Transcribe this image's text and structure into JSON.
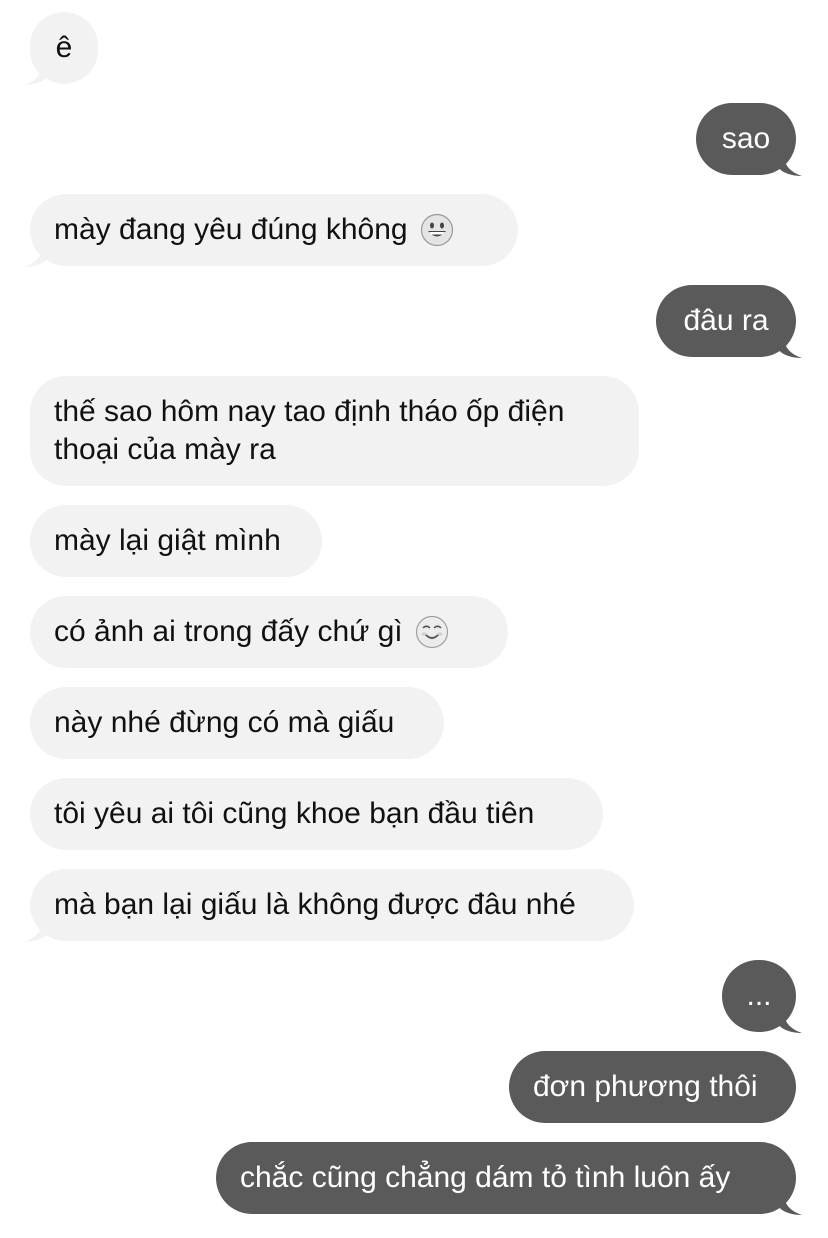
{
  "conversation": {
    "messages": [
      {
        "side": "in",
        "text": "ê"
      },
      {
        "side": "out",
        "text": "sao"
      },
      {
        "side": "in",
        "text": "mày đang yêu đúng không",
        "emoji": "grinning-face-icon"
      },
      {
        "side": "out",
        "text": "đâu ra"
      },
      {
        "side": "in",
        "text": "thế sao hôm nay tao định tháo ốp điện thoại của mày ra"
      },
      {
        "side": "in",
        "text": "mày lại giật mình"
      },
      {
        "side": "in",
        "text": "có ảnh ai trong đấy chứ gì",
        "emoji": "smiling-face-icon"
      },
      {
        "side": "in",
        "text": "này nhé đừng có mà giấu"
      },
      {
        "side": "in",
        "text": "tôi yêu ai tôi cũng khoe bạn đầu tiên"
      },
      {
        "side": "in",
        "text": "mà bạn lại giấu là không được đâu nhé"
      },
      {
        "side": "out",
        "text": "..."
      },
      {
        "side": "out",
        "text": "đơn phương thôi"
      },
      {
        "side": "out",
        "text": "chắc cũng chẳng dám tỏ tình luôn ấy"
      }
    ]
  },
  "colors": {
    "incoming_bubble": "#f2f2f2",
    "outgoing_bubble": "#5a5a5a",
    "incoming_text": "#111111",
    "outgoing_text": "#ffffff"
  }
}
